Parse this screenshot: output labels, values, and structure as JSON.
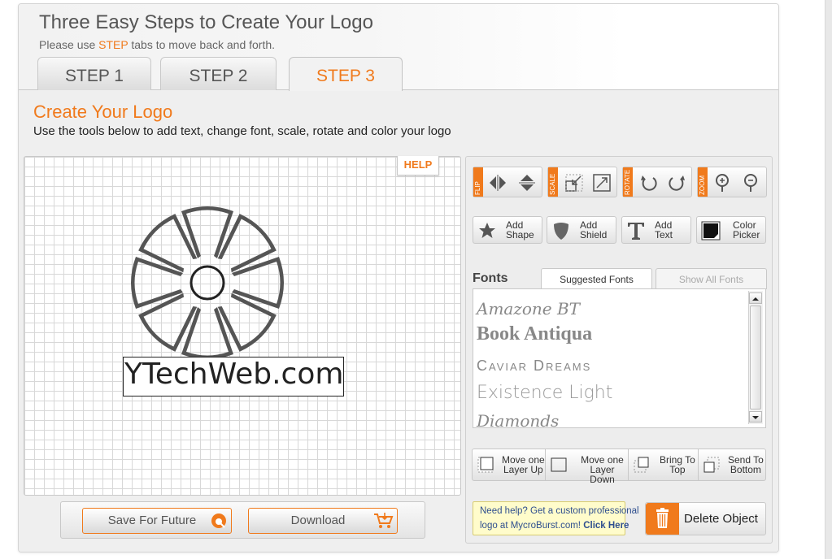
{
  "header": {
    "title": "Three Easy Steps to Create Your Logo",
    "subtitle_before": "Please use ",
    "subtitle_highlight": "STEP",
    "subtitle_after": " tabs to move back and forth."
  },
  "tabs": [
    {
      "label": "STEP 1",
      "active": false
    },
    {
      "label": "STEP 2",
      "active": false
    },
    {
      "label": "STEP 3",
      "active": true
    }
  ],
  "section": {
    "title": "Create Your Logo",
    "description": "Use the tools below to add text, change font, scale, rotate and color your logo"
  },
  "canvas": {
    "help_label": "HELP",
    "logo_text": "YTechWeb.com"
  },
  "actions": {
    "save_label": "Save For Future",
    "download_label": "Download"
  },
  "toolbar": {
    "flip_label": "FLIP",
    "scale_label": "SCALE",
    "rotate_label": "ROTATE",
    "zoom_label": "ZOOM"
  },
  "add_buttons": {
    "shape": [
      "Add",
      "Shape"
    ],
    "shield": [
      "Add",
      "Shield"
    ],
    "text": [
      "Add",
      "Text"
    ],
    "color": [
      "Color",
      "Picker"
    ]
  },
  "fonts": {
    "label": "Fonts",
    "tab_suggested": "Suggested Fonts",
    "tab_all": "Show All Fonts",
    "items": [
      "Amazone BT",
      "Book Antiqua",
      "Caviar Dreams",
      "Existence Light",
      "Diamonds"
    ]
  },
  "layers": {
    "move_up": [
      "Move one",
      "Layer Up"
    ],
    "move_down": [
      "Move one",
      "Layer Down"
    ],
    "bring_top": [
      "Bring To",
      "Top"
    ],
    "send_bottom": [
      "Send To",
      "Bottom"
    ]
  },
  "help_banner": {
    "line1": "Need help? Get a custom professional",
    "line2": "logo at MycroBurst.com!",
    "link": "Click Here"
  },
  "delete_label": "Delete Object",
  "colors": {
    "accent": "#f07a1c",
    "panel_bg": "#efefef",
    "banner_bg": "#fffccb"
  }
}
